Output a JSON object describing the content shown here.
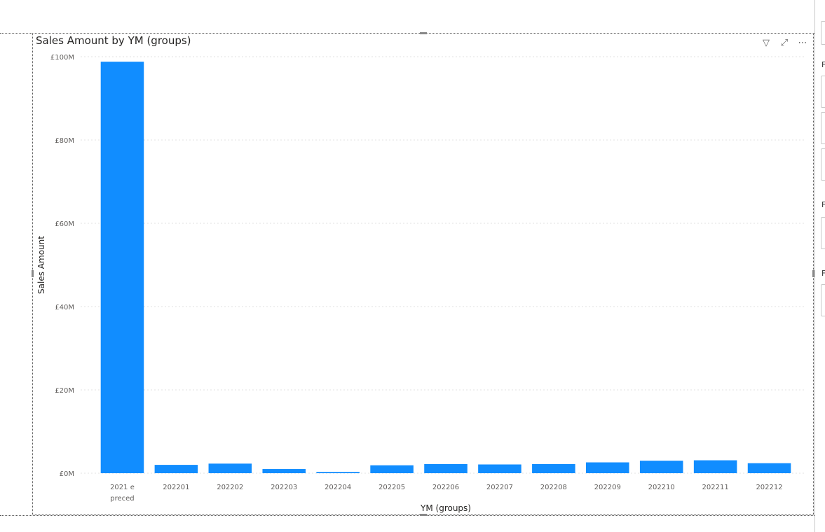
{
  "visual": {
    "title": "Sales Amount by YM (groups)",
    "icons": [
      {
        "name": "filter-icon",
        "glyph": "▽"
      },
      {
        "name": "focus-mode-icon",
        "glyph": "⤢"
      },
      {
        "name": "more-options-icon",
        "glyph": "⋯"
      }
    ]
  },
  "side_pane": {
    "letters": [
      "F",
      "F",
      "F"
    ]
  },
  "chart_data": {
    "type": "bar",
    "categories": [
      "2021 e preced",
      "202201",
      "202202",
      "202203",
      "202204",
      "202205",
      "202206",
      "202207",
      "202208",
      "202209",
      "202210",
      "202211",
      "202212"
    ],
    "category_lines": [
      [
        "2021 e",
        "preced"
      ],
      [
        "202201"
      ],
      [
        "202202"
      ],
      [
        "202203"
      ],
      [
        "202204"
      ],
      [
        "202205"
      ],
      [
        "202206"
      ],
      [
        "202207"
      ],
      [
        "202208"
      ],
      [
        "202209"
      ],
      [
        "202210"
      ],
      [
        "202211"
      ],
      [
        "202212"
      ]
    ],
    "values": [
      98.8,
      2.0,
      2.3,
      1.0,
      0.3,
      1.9,
      2.2,
      2.1,
      2.2,
      2.6,
      3.0,
      3.1,
      2.4
    ],
    "value_unit": "£M",
    "title": "Sales Amount by YM (groups)",
    "xlabel": "YM (groups)",
    "ylabel": "Sales Amount",
    "ylim": [
      0,
      100
    ],
    "yticks": [
      0,
      20,
      40,
      60,
      80,
      100
    ],
    "ytick_labels": [
      "£0M",
      "£20M",
      "£40M",
      "£60M",
      "£80M",
      "£100M"
    ],
    "grid": true,
    "bar_color": "#118DFF",
    "grid_color": "#e1e1e1",
    "tick_label_color": "#605E5C",
    "axis_title_color": "#252423"
  }
}
